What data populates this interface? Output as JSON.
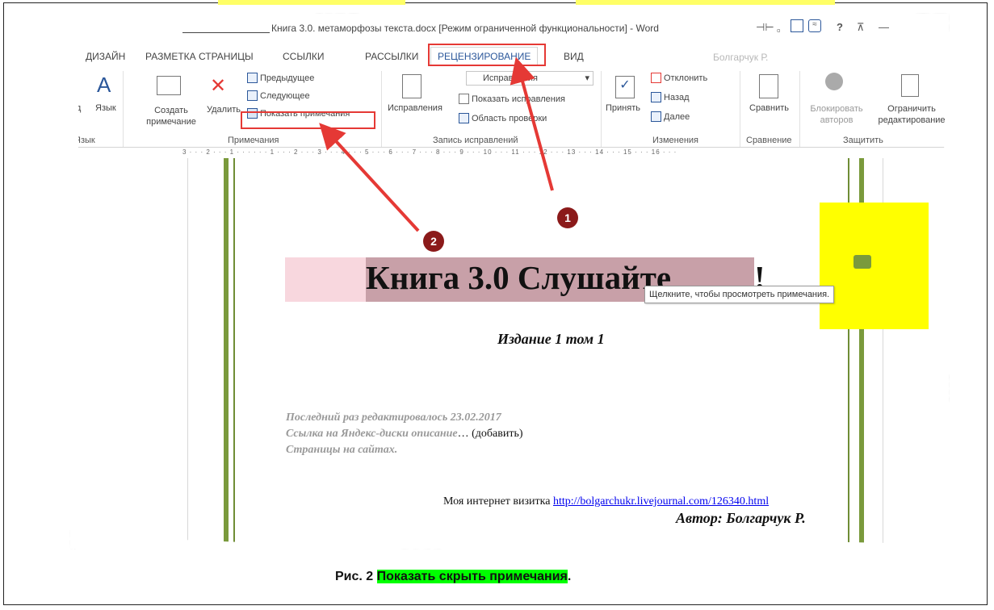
{
  "window": {
    "title": "Книга 3.0. метаморфозы текста.docx [Режим ограниченной функциональности] - Word",
    "controls": [
      "?",
      "—"
    ]
  },
  "tabs": [
    "ДИЗАЙН",
    "РАЗМЕТКА СТРАНИЦЫ",
    "ССЫЛКИ",
    "РАССЫЛКИ",
    "РЕЦЕНЗИРОВАНИЕ",
    "ВИД"
  ],
  "user": "Болгарчук Р.",
  "ribbon": {
    "lang": {
      "partial": "од",
      "label": "Язык",
      "group": "Язык"
    },
    "comments": {
      "create": "Создать примечание",
      "delete": "Удалить",
      "previous": "Предыдущее",
      "next": "Следующее",
      "show": "Показать примечания",
      "group": "Примечания"
    },
    "tracking": {
      "button": "Исправления",
      "combo": "Исправления",
      "show_markup": "Показать исправления",
      "review_pane": "Область проверки",
      "group": "Запись исправлений"
    },
    "changes": {
      "accept": "Принять",
      "reject": "Отклонить",
      "previous": "Назад",
      "next": "Далее",
      "group": "Изменения"
    },
    "compare": {
      "button": "Сравнить",
      "group": "Сравнение"
    },
    "protect": {
      "block": "Блокировать авторов",
      "restrict": "Ограничить редактирование",
      "group": "Защитить"
    }
  },
  "ruler": "3 · · · 2 · · · 1 · · · · · · 1 · · · 2 · · · 3 · · · 4 · · · 5 · · · 6 · · · 7 · · · 8 · · · 9 · · · 10 · · · 11 · · · 12 · · · 13 · · · 14 · · · 15 · · · 16 · · ·",
  "document": {
    "title": "Книга 3.0 Слушайте",
    "title_end": "!",
    "tooltip": "Щелкните, чтобы просмотреть примечания.",
    "subtitle": "Издание 1 том 1",
    "last_edit": "Последний раз редактировалось 23.02.2017",
    "link_line": "Ссылка на Яндекс-диски описание",
    "link_suffix": "… (добавить)",
    "sites": "Страницы на сайтах.",
    "visit_label": "Моя интернет визитка",
    "visit_url": "http://bolgarchukr.livejournal.com/126340.html",
    "author": "Автор: Болгарчук Р."
  },
  "markers": {
    "one": "1",
    "two": "2"
  },
  "caption": {
    "prefix": "Рис. 2",
    "highlight": "Показать скрыть примечания",
    "suffix": "."
  },
  "colors": {
    "accent": "#2b579a",
    "annotation_red": "#e53935",
    "marker": "#8b1a1a",
    "caption_highlight": "#00ff00",
    "highlight_yellow": "#ffff00"
  }
}
